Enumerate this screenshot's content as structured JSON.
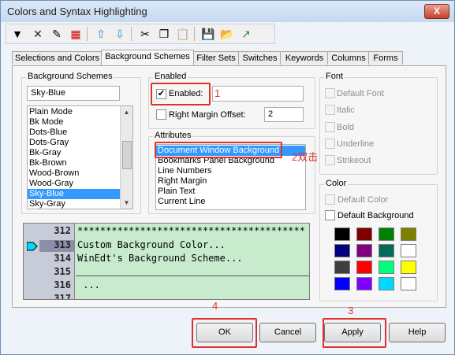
{
  "window": {
    "title": "Colors and Syntax Highlighting",
    "close_label": "X"
  },
  "toolbar": {
    "items": [
      {
        "icon": "dropdown-arrow-icon",
        "glyph": "▼"
      },
      {
        "icon": "delete-icon",
        "glyph": "✕"
      },
      {
        "icon": "brush-icon",
        "glyph": "✎"
      },
      {
        "icon": "palette-icon",
        "glyph": "▦"
      },
      {
        "icon": "move-up-icon",
        "glyph": "⇧"
      },
      {
        "icon": "move-down-icon",
        "glyph": "⇩"
      },
      {
        "icon": "cut-icon",
        "glyph": "✂"
      },
      {
        "icon": "copy-icon",
        "glyph": "❐"
      },
      {
        "icon": "paste-icon",
        "glyph": "📋"
      },
      {
        "icon": "save-icon",
        "glyph": "💾"
      },
      {
        "icon": "open-folder-icon",
        "glyph": "📂"
      },
      {
        "icon": "export-icon",
        "glyph": "↗"
      }
    ]
  },
  "tabs": [
    {
      "label": "Selections and Colors"
    },
    {
      "label": "Background Schemes"
    },
    {
      "label": "Filter Sets"
    },
    {
      "label": "Switches"
    },
    {
      "label": "Keywords"
    },
    {
      "label": "Columns"
    },
    {
      "label": "Forms"
    }
  ],
  "schemes": {
    "title": "Background Schemes",
    "current_value": "Sky-Blue",
    "items": [
      "Plain Mode",
      "Bk Mode",
      "Dots-Blue",
      "Dots-Gray",
      "Bk-Gray",
      "Bk-Brown",
      "Wood-Brown",
      "Wood-Gray",
      "Sky-Blue",
      "Sky-Gray"
    ],
    "selected": "Sky-Blue"
  },
  "enabled": {
    "title": "Enabled",
    "enabled_label": "Enabled:",
    "enabled_checked": true,
    "enabled_value": "",
    "margin_label": "Right Margin Offset:",
    "margin_value": "2"
  },
  "attributes": {
    "title": "Attributes",
    "items": [
      "Document Window Background",
      "Bookmarks Panel  Background",
      "Line Numbers",
      "Right Margin",
      "Plain Text",
      "Current Line"
    ],
    "selected": "Document Window Background"
  },
  "font": {
    "title": "Font",
    "options": [
      "Default Font",
      "Italic",
      "Bold",
      "Underline",
      "Strikeout"
    ]
  },
  "color": {
    "title": "Color",
    "default_color_label": "Default Color",
    "default_background_label": "Default Background",
    "swatches": [
      "#000000",
      "#800000",
      "#008000",
      "#808000",
      "#000080",
      "#800080",
      "#006b56",
      "#ffffff",
      "#3f3f3f",
      "#ff0000",
      "#00ff7f",
      "#ffff00",
      "#0000ff",
      "#8000ff",
      "#00d8ff",
      "#ffffff"
    ]
  },
  "preview": {
    "lines": [
      {
        "num": "312",
        "text": "****************************************"
      },
      {
        "num": "313",
        "text": "Custom Background Color..."
      },
      {
        "num": "314",
        "text": "WinEdt's Background Scheme..."
      },
      {
        "num": "315",
        "text": ""
      },
      {
        "num": "316",
        "text": " ..."
      },
      {
        "num": "317",
        "text": ""
      }
    ]
  },
  "buttons": {
    "ok": "OK",
    "cancel": "Cancel",
    "apply": "Apply",
    "help": "Help"
  },
  "annotations": {
    "a1": "1",
    "a2": "2双击",
    "a3": "3",
    "a4": "4"
  }
}
